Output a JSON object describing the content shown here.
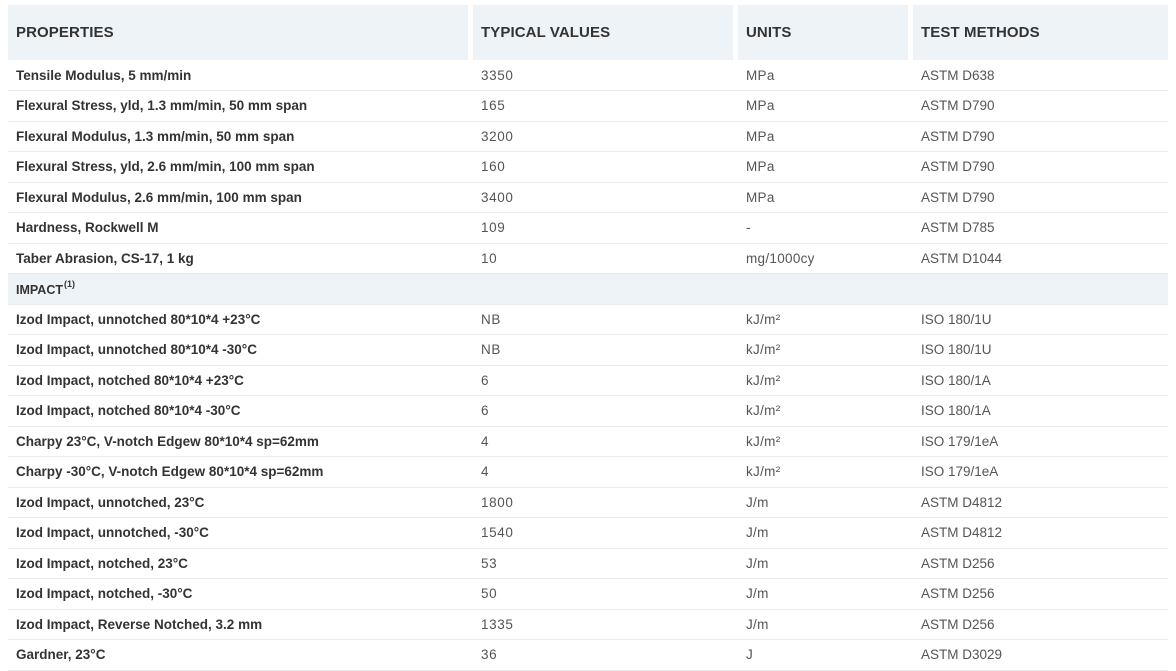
{
  "headers": {
    "properties": "PROPERTIES",
    "typical_values": "TYPICAL VALUES",
    "units": "UNITS",
    "test_methods": "TEST METHODS"
  },
  "rows_top": [
    {
      "property": "Tensile Modulus, 5 mm/min",
      "value": "3350",
      "unit": "MPa",
      "test": "ASTM D638"
    },
    {
      "property": "Flexural Stress, yld, 1.3 mm/min, 50 mm span",
      "value": "165",
      "unit": "MPa",
      "test": "ASTM D790"
    },
    {
      "property": "Flexural Modulus, 1.3 mm/min, 50 mm span",
      "value": "3200",
      "unit": "MPa",
      "test": "ASTM D790"
    },
    {
      "property": "Flexural Stress, yld, 2.6 mm/min, 100 mm span",
      "value": "160",
      "unit": "MPa",
      "test": "ASTM D790"
    },
    {
      "property": "Flexural Modulus, 2.6 mm/min, 100 mm span",
      "value": "3400",
      "unit": "MPa",
      "test": "ASTM D790"
    },
    {
      "property": "Hardness, Rockwell M",
      "value": "109",
      "unit": "-",
      "test": "ASTM D785"
    },
    {
      "property": "Taber Abrasion, CS-17, 1 kg",
      "value": "10",
      "unit": "mg/1000cy",
      "test": "ASTM D1044"
    }
  ],
  "section": {
    "label": "IMPACT",
    "footnote": "(1)"
  },
  "rows_impact": [
    {
      "property": "Izod Impact, unnotched 80*10*4 +23°C",
      "value": "NB",
      "unit": "kJ/m²",
      "test": "ISO 180/1U"
    },
    {
      "property": "Izod Impact, unnotched 80*10*4 -30°C",
      "value": "NB",
      "unit": "kJ/m²",
      "test": "ISO 180/1U"
    },
    {
      "property": "Izod Impact, notched 80*10*4 +23°C",
      "value": "6",
      "unit": "kJ/m²",
      "test": "ISO 180/1A"
    },
    {
      "property": "Izod Impact, notched 80*10*4 -30°C",
      "value": "6",
      "unit": "kJ/m²",
      "test": "ISO 180/1A"
    },
    {
      "property": "Charpy 23°C, V-notch Edgew 80*10*4 sp=62mm",
      "value": "4",
      "unit": "kJ/m²",
      "test": "ISO 179/1eA"
    },
    {
      "property": "Charpy -30°C, V-notch Edgew 80*10*4 sp=62mm",
      "value": "4",
      "unit": "kJ/m²",
      "test": "ISO 179/1eA"
    },
    {
      "property": "Izod Impact, unnotched, 23°C",
      "value": "1800",
      "unit": "J/m",
      "test": "ASTM D4812"
    },
    {
      "property": "Izod Impact, unnotched, -30°C",
      "value": "1540",
      "unit": "J/m",
      "test": "ASTM D4812"
    },
    {
      "property": "Izod Impact, notched, 23°C",
      "value": "53",
      "unit": "J/m",
      "test": "ASTM D256"
    },
    {
      "property": "Izod Impact, notched, -30°C",
      "value": "50",
      "unit": "J/m",
      "test": "ASTM D256"
    },
    {
      "property": "Izod Impact, Reverse Notched, 3.2 mm",
      "value": "1335",
      "unit": "J/m",
      "test": "ASTM D256"
    },
    {
      "property": "Gardner, 23°C",
      "value": "36",
      "unit": "J",
      "test": "ASTM D3029"
    }
  ],
  "colors": {
    "header_bg": "#eef3f7",
    "row_border": "#e9ecef",
    "text_dark": "#333333",
    "text_muted": "#555555"
  }
}
